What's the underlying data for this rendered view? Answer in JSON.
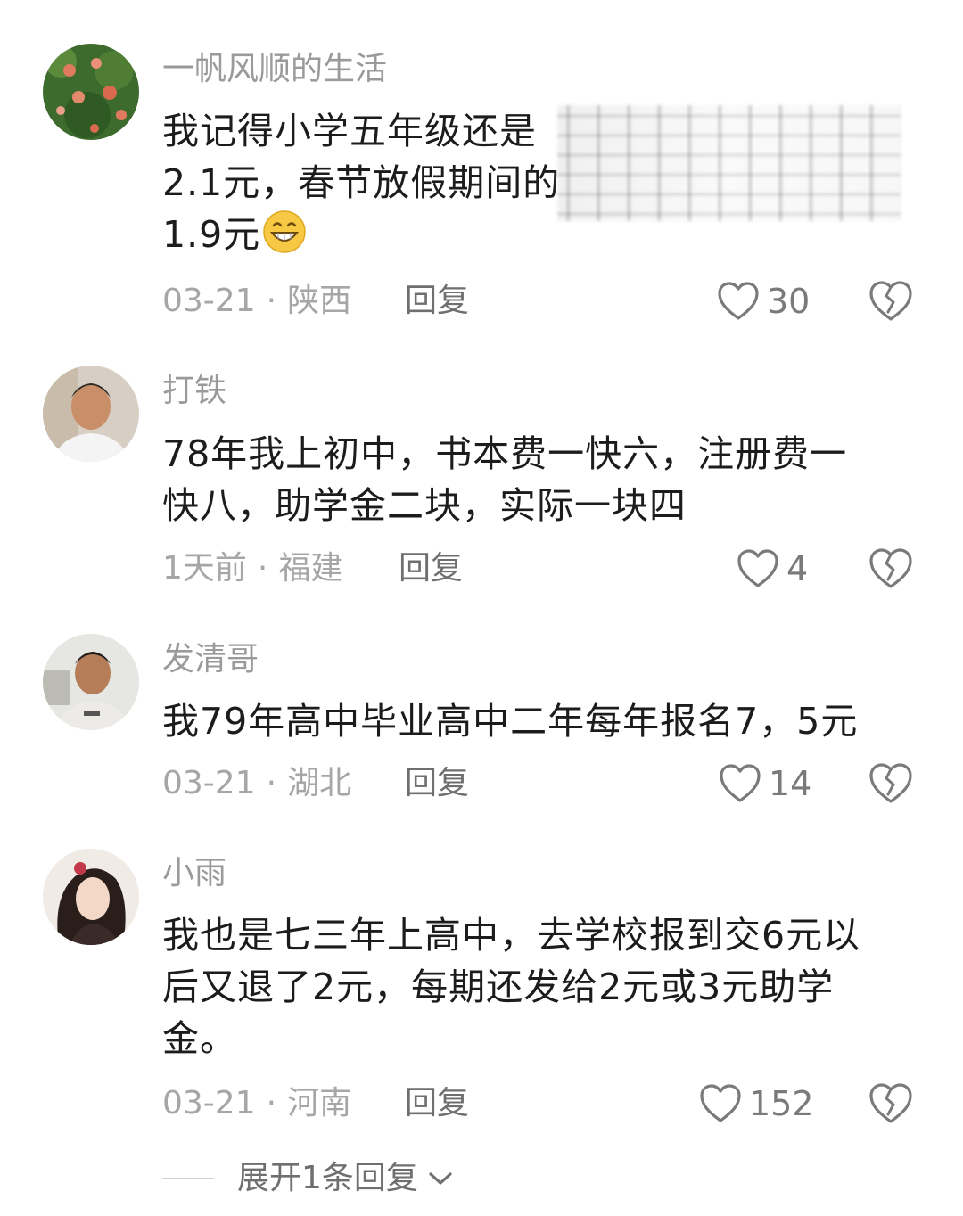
{
  "comments": [
    {
      "username": "一帆风顺的生活",
      "lines": [
        "我记得小学五年级还是",
        "2.1元，春节放假期间的",
        "1.9元"
      ],
      "emoji": "grinning-face-emoji",
      "time": "03-21",
      "region": "陕西",
      "reply_label": "回复",
      "likes": "30"
    },
    {
      "username": "打铁",
      "lines": [
        "78年我上初中，书本费一快六，注册费一",
        "快八，助学金二块，实际一块四"
      ],
      "time": "1天前",
      "region": "福建",
      "reply_label": "回复",
      "likes": "4"
    },
    {
      "username": "发清哥",
      "lines": [
        "我79年高中毕业高中二年每年报名7，5元"
      ],
      "time": "03-21",
      "region": "湖北",
      "reply_label": "回复",
      "likes": "14"
    },
    {
      "username": "小雨",
      "lines": [
        "我也是七三年上高中，去学校报到交6元以",
        "后又退了2元，每期还发给2元或3元助学",
        "金。"
      ],
      "time": "03-21",
      "region": "河南",
      "reply_label": "回复",
      "likes": "152"
    }
  ],
  "separator": "·",
  "expand_label": "展开1条回复",
  "icons": {
    "like": "heart-outline-icon",
    "dislike": "broken-heart-icon",
    "expand": "chevron-down-icon"
  },
  "colors": {
    "username": "#9a9a9a",
    "text": "#1c1c1c",
    "meta": "#a6a6a6",
    "reply": "#6f6f6f",
    "icon": "#7a7a7a"
  }
}
